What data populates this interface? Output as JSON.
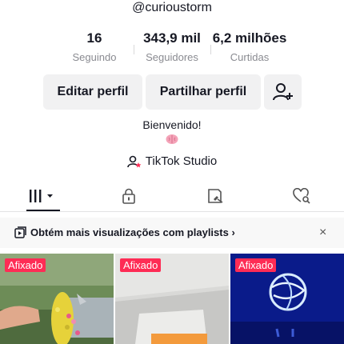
{
  "profile": {
    "username": "@curioustorm",
    "bio": "Bienvenido!",
    "bio_emoji": "brain-emoji-icon"
  },
  "stats": [
    {
      "value": "16",
      "label": "Seguindo"
    },
    {
      "value": "343,9 mil",
      "label": "Seguidores"
    },
    {
      "value": "6,2 milhões",
      "label": "Curtidas"
    }
  ],
  "actions": {
    "edit_label": "Editar perfil",
    "share_label": "Partilhar perfil",
    "add_friend_icon": "add-user-icon"
  },
  "studio": {
    "label": "TikTok Studio",
    "icon": "user-star-icon"
  },
  "tabs": [
    {
      "icon": "videos-grid-icon",
      "active": true
    },
    {
      "icon": "lock-icon",
      "active": false
    },
    {
      "icon": "saved-icon",
      "active": false
    },
    {
      "icon": "liked-heart-icon",
      "active": false
    }
  ],
  "banner": {
    "text": "Obtém mais visualizações com playlists",
    "chevron": "›",
    "close": "×"
  },
  "videos": [
    {
      "badge": "Afixado"
    },
    {
      "badge": "Afixado"
    },
    {
      "badge": "Afixado"
    }
  ],
  "colors": {
    "accent": "#fe2c55",
    "text": "#161823",
    "muted": "#8a8b91",
    "button_bg": "#f1f1f2"
  }
}
